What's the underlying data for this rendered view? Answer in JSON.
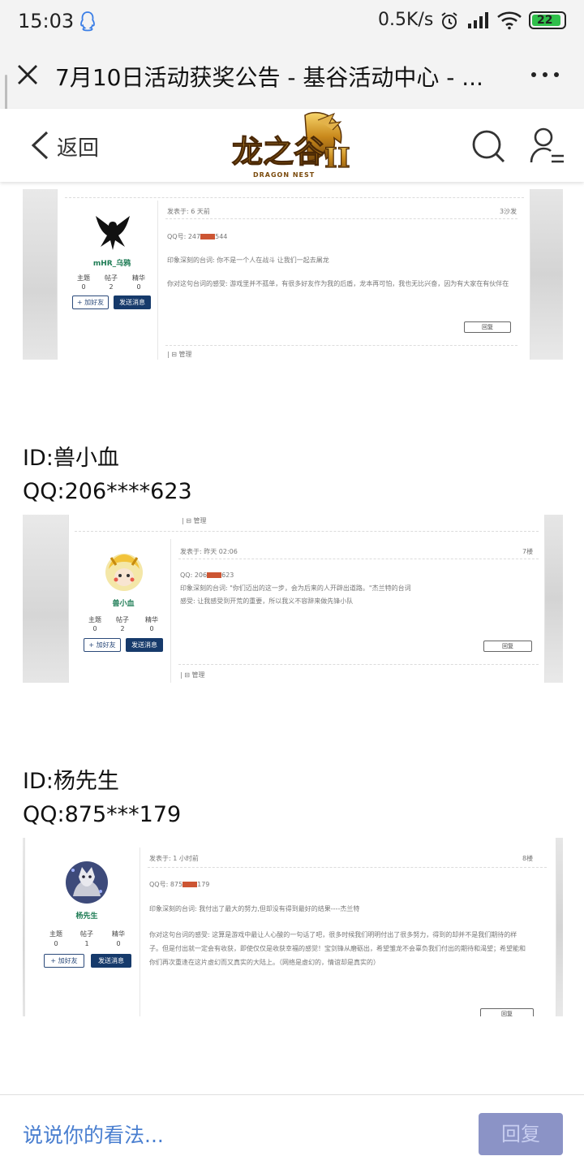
{
  "status_bar": {
    "time": "15:03",
    "network_speed": "0.5K/s",
    "battery_level": "22",
    "battery_fraction": 0.22,
    "icons": [
      "qq-icon",
      "alarm-icon",
      "signal-icon",
      "wifi-icon",
      "battery-icon"
    ]
  },
  "browser": {
    "title": "7月10日活动获奖公告 - 基谷活动中心 - ...",
    "close_icon": "close-icon",
    "more_icon": "more-icon"
  },
  "site_header": {
    "back_label": "返回",
    "logo_text": "龙之谷",
    "logo_subtext": "DRAGON NEST",
    "logo_numeral": "II",
    "icons": [
      "back-icon",
      "search-icon",
      "user-menu-icon"
    ]
  },
  "posts": [
    {
      "screenshot": {
        "post_time": "发表于: 6 天前",
        "floor": "3沙发",
        "qq_prefix": "QQ号: 247",
        "qq_suffix": "544",
        "line1": "印象深刻的台词: 你不是一个人在战斗 让我们一起去屠龙",
        "line2": "你对这句台词的感受: 游戏里并不孤单，有很多好友作为我的后盾，龙本再可怕，我也无比兴奋，因为有大家在有伙伴在",
        "username": "mHR_乌鸦",
        "stat_labels": [
          "主题",
          "帖子",
          "精华"
        ],
        "stat_values": [
          "0",
          "2",
          "0"
        ],
        "add_friend": "+ 加好友",
        "send_message": "发送消息",
        "reply": "回复",
        "manage": "| ⊟ 管理"
      }
    },
    {
      "id_label": "ID:兽小血",
      "qq_label": "QQ:206****623",
      "screenshot": {
        "top_manage": "| ⊟ 管理",
        "post_time": "发表于: 昨天 02:06",
        "floor": "7楼",
        "qq_prefix": "QQ: 206",
        "qq_suffix": "623",
        "line1": "印象深刻的台词: \"你们迈出的这一步，会为后来的人开辟出道路。\"杰兰特的台词",
        "line2": "感受: 让我感受到开荒的重要，所以我义不容辞来做先锋小队",
        "username": "兽小血",
        "stat_labels": [
          "主题",
          "帖子",
          "精华"
        ],
        "stat_values": [
          "0",
          "2",
          "0"
        ],
        "add_friend": "+ 加好友",
        "send_message": "发送消息",
        "reply": "回复",
        "manage": "| ⊟ 管理"
      }
    },
    {
      "id_label": "ID:杨先生",
      "qq_label": "QQ:875***179",
      "screenshot": {
        "post_time": "发表于: 1 小时前",
        "floor": "8楼",
        "qq_prefix": "QQ号: 875",
        "qq_suffix": "179",
        "line1": "印象深刻的台词: 我付出了最大的努力,但却没有得到最好的结果----杰兰特",
        "line2": "你对这句台词的感受: 这算是游戏中最让人心酸的一句话了吧，很多时候我们明明付出了很多努力，得到的却并不是我们期待的样",
        "line3": "子。但是付出就一定会有收获，即使仅仅是收获幸福的感觉！宝剑锋从磨砺出，希望雏龙不会辜负我们付出的期待和渴望；希望能和",
        "line4": "你们再次重逢在这片虚幻而又真实的大陆上。（网络是虚幻的，情谊却是真实的）",
        "username": "杨先生",
        "stat_labels": [
          "主题",
          "帖子",
          "精华"
        ],
        "stat_values": [
          "0",
          "1",
          "0"
        ],
        "add_friend": "+ 加好友",
        "send_message": "发送消息",
        "reply": "回复"
      }
    }
  ],
  "bottom_bar": {
    "comment_placeholder": "说说你的看法...",
    "reply_button": "回复"
  },
  "colors": {
    "accent_link": "#4a7fd0",
    "reply_button": "#8b93c6",
    "forum_button": "#163a6b",
    "username_green": "#1e7c55",
    "battery_green": "#2fbf4a"
  }
}
